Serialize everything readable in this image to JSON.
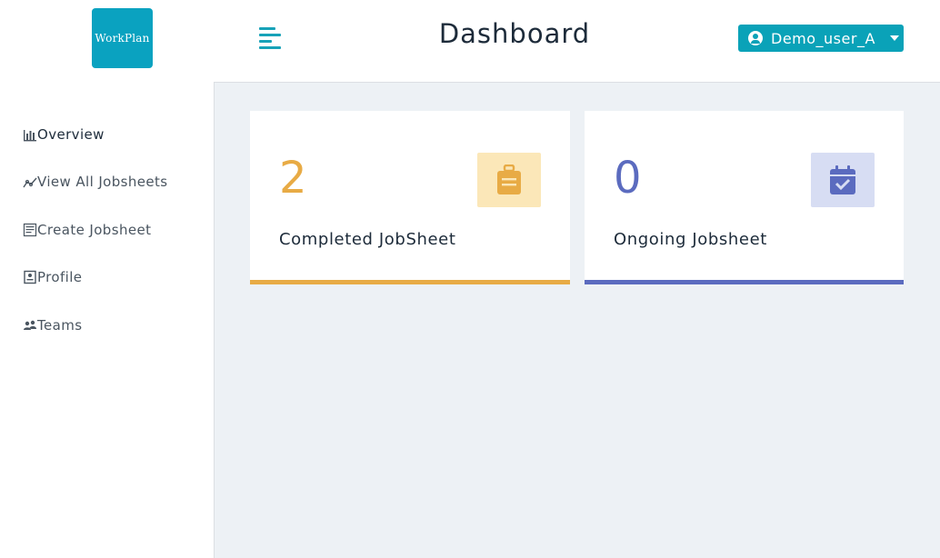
{
  "header": {
    "logo_text": "WorkPlan",
    "page_title": "Dashboard",
    "user": {
      "name": "Demo_user_A"
    }
  },
  "sidebar": {
    "items": [
      {
        "label": "Overview",
        "icon": "bar-chart-icon",
        "active": true
      },
      {
        "label": "View All Jobsheets",
        "icon": "line-chart-icon",
        "active": false
      },
      {
        "label": "Create Jobsheet",
        "icon": "form-icon",
        "active": false
      },
      {
        "label": "Profile",
        "icon": "id-card-icon",
        "active": false
      },
      {
        "label": "Teams",
        "icon": "people-icon",
        "active": false
      }
    ]
  },
  "cards": [
    {
      "count": "2",
      "label": "Completed JobSheet",
      "icon": "suitcase-icon",
      "accent": "#e8ab45",
      "icon_bg": "#fbe7b8"
    },
    {
      "count": "0",
      "label": "Ongoing Jobsheet",
      "icon": "calendar-check-icon",
      "accent": "#5b6bbf",
      "icon_bg": "#d7ddf3"
    }
  ],
  "colors": {
    "brand": "#0aa2c0",
    "sidebar_icon": "#4a5560",
    "background": "#edf1f5"
  }
}
